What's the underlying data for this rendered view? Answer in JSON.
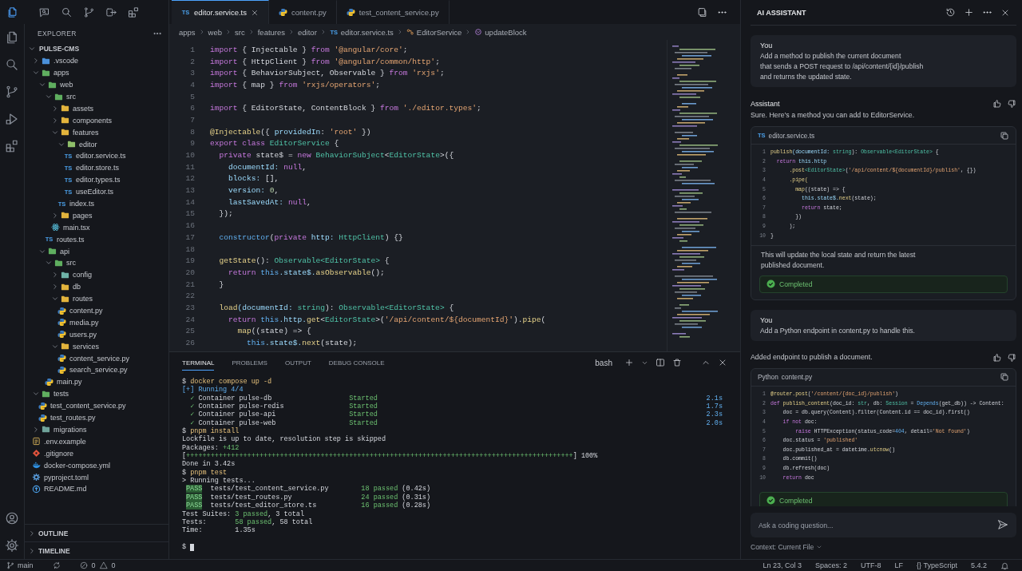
{
  "top_bar": {
    "icons": [
      {
        "kind": "files",
        "selected": true
      },
      {
        "kind": "chat",
        "selected": false
      },
      {
        "kind": "search",
        "selected": false
      },
      {
        "kind": "branch",
        "selected": false
      },
      {
        "kind": "remote",
        "selected": false
      },
      {
        "kind": "ext",
        "selected": false
      }
    ]
  },
  "activity_bar": {
    "items": [
      {
        "kind": "files"
      },
      {
        "kind": "search"
      },
      {
        "kind": "branch"
      },
      {
        "kind": "run"
      },
      {
        "kind": "ext"
      }
    ],
    "bottom": [
      {
        "kind": "account"
      },
      {
        "kind": "gear"
      }
    ]
  },
  "explorer": {
    "title": "EXPLORER",
    "root": {
      "name": "PULSE-CMS",
      "kind": "folder",
      "expanded": true,
      "children": [
        {
          "name": ".vscode",
          "kind": "folder",
          "color": "#4a90d9",
          "expanded": false
        },
        {
          "name": "apps",
          "kind": "folder",
          "color": "#5fae5f",
          "expanded": true,
          "children": [
            {
              "name": "web",
              "kind": "folder",
              "color": "#5fae5f",
              "expanded": true,
              "children": [
                {
                  "name": "src",
                  "kind": "folder",
                  "color": "#5fae5f",
                  "expanded": true,
                  "children": [
                    {
                      "name": "assets",
                      "kind": "folder",
                      "color": "#e2b33c",
                      "expanded": false
                    },
                    {
                      "name": "components",
                      "kind": "folder",
                      "color": "#e2b33c",
                      "expanded": false
                    },
                    {
                      "name": "features",
                      "kind": "folder",
                      "color": "#e2b33c",
                      "expanded": true,
                      "children": [
                        {
                          "name": "editor",
                          "kind": "folder",
                          "color": "#8fbf6a",
                          "expanded": true,
                          "children": [
                            {
                              "name": "editor.service.ts",
                              "kind": "ts",
                              "badge": "TS"
                            },
                            {
                              "name": "editor.store.ts",
                              "kind": "ts",
                              "badge": "TS"
                            },
                            {
                              "name": "editor.types.ts",
                              "kind": "ts",
                              "badge": "TS"
                            },
                            {
                              "name": "useEditor.ts",
                              "kind": "ts",
                              "badge": "TS"
                            }
                          ]
                        },
                        {
                          "name": "index.ts",
                          "kind": "ts",
                          "badge": "TS"
                        }
                      ]
                    },
                    {
                      "name": "pages",
                      "kind": "folder",
                      "color": "#e2b33c",
                      "expanded": false
                    },
                    {
                      "name": "main.tsx",
                      "kind": "react"
                    }
                  ]
                },
                {
                  "name": "routes.ts",
                  "kind": "ts",
                  "badge": "TS"
                }
              ]
            },
            {
              "name": "api",
              "kind": "folder",
              "color": "#5fae5f",
              "expanded": true,
              "children": [
                {
                  "name": "src",
                  "kind": "folder",
                  "color": "#5fae5f",
                  "expanded": true,
                  "children": [
                    {
                      "name": "config",
                      "kind": "folder",
                      "color": "#6fb3a8",
                      "expanded": false
                    },
                    {
                      "name": "db",
                      "kind": "folder",
                      "color": "#e2b33c",
                      "expanded": false
                    },
                    {
                      "name": "routes",
                      "kind": "folder",
                      "color": "#e2b33c",
                      "expanded": true,
                      "children": [
                        {
                          "name": "content.py",
                          "kind": "py"
                        },
                        {
                          "name": "media.py",
                          "kind": "py"
                        },
                        {
                          "name": "users.py",
                          "kind": "py"
                        }
                      ]
                    },
                    {
                      "name": "services",
                      "kind": "folder",
                      "color": "#e2b33c",
                      "expanded": true,
                      "children": [
                        {
                          "name": "content_service.py",
                          "kind": "py"
                        },
                        {
                          "name": "search_service.py",
                          "kind": "py"
                        }
                      ]
                    }
                  ]
                },
                {
                  "name": "main.py",
                  "kind": "py"
                }
              ]
            }
          ]
        },
        {
          "name": "tests",
          "kind": "folder",
          "color": "#5fae5f",
          "expanded": true,
          "children": [
            {
              "name": "test_content_service.py",
              "kind": "py"
            },
            {
              "name": "test_routes.py",
              "kind": "py"
            }
          ]
        },
        {
          "name": "migrations",
          "kind": "folder",
          "color": "#6fa39a",
          "expanded": false
        },
        {
          "name": ".env.example",
          "kind": "env"
        },
        {
          "name": ".gitignore",
          "kind": "git"
        },
        {
          "name": "docker-compose.yml",
          "kind": "docker"
        },
        {
          "name": "pyproject.toml",
          "kind": "toml"
        },
        {
          "name": "README.md",
          "kind": "md"
        }
      ]
    },
    "sections": [
      {
        "label": "OUTLINE",
        "expanded": false
      },
      {
        "label": "TIMELINE",
        "expanded": false
      }
    ]
  },
  "editor": {
    "tabs": [
      {
        "label": "editor.service.ts",
        "kind": "ts",
        "badge": "TS",
        "selected": true
      },
      {
        "label": "content.py",
        "kind": "py",
        "selected": false
      },
      {
        "label": "test_content_service.py",
        "kind": "py",
        "selected": false
      }
    ],
    "breadcrumb": [
      {
        "label": "apps",
        "kind": "folder"
      },
      {
        "label": "web",
        "kind": "folder"
      },
      {
        "label": "src",
        "kind": "folder"
      },
      {
        "label": "features",
        "kind": "folder"
      },
      {
        "label": "editor",
        "kind": "folder"
      },
      {
        "label": "editor.service.ts",
        "kind": "ts",
        "badge": "TS"
      },
      {
        "label": "EditorService",
        "kind": "class"
      },
      {
        "label": "updateBlock",
        "kind": "method"
      }
    ],
    "lines": [
      {
        "n": "1",
        "tokens": [
          {
            "text": "import ",
            "kind": "kw"
          },
          {
            "text": "{ Injectable } ",
            "kind": "p"
          },
          {
            "text": "from ",
            "kind": "kw"
          },
          {
            "text": "'@angular/core'",
            "kind": "str"
          },
          {
            "text": ";",
            "kind": "p"
          }
        ]
      },
      {
        "n": "2",
        "tokens": [
          {
            "text": "import ",
            "kind": "kw"
          },
          {
            "text": "{ HttpClient } ",
            "kind": "p"
          },
          {
            "text": "from ",
            "kind": "kw"
          },
          {
            "text": "'@angular/common/http'",
            "kind": "str"
          },
          {
            "text": ";",
            "kind": "p"
          }
        ]
      },
      {
        "n": "3",
        "tokens": [
          {
            "text": "import ",
            "kind": "kw"
          },
          {
            "text": "{ BehaviorSubject, Observable } ",
            "kind": "p"
          },
          {
            "text": "from ",
            "kind": "kw"
          },
          {
            "text": "'rxjs'",
            "kind": "str"
          },
          {
            "text": ";",
            "kind": "p"
          }
        ]
      },
      {
        "n": "4",
        "tokens": [
          {
            "text": "import ",
            "kind": "kw"
          },
          {
            "text": "{ map } ",
            "kind": "p"
          },
          {
            "text": "from ",
            "kind": "kw"
          },
          {
            "text": "'rxjs/operators'",
            "kind": "str"
          },
          {
            "text": ";",
            "kind": "p"
          }
        ]
      },
      {
        "n": "5"
      },
      {
        "n": "6",
        "tokens": [
          {
            "text": "import ",
            "kind": "kw"
          },
          {
            "text": "{ EditorState, ContentBlock } ",
            "kind": "p"
          },
          {
            "text": "from ",
            "kind": "kw"
          },
          {
            "text": "'./editor.types'",
            "kind": "str"
          },
          {
            "text": ";",
            "kind": "p"
          }
        ]
      },
      {
        "n": "7"
      },
      {
        "n": "8",
        "tokens": [
          {
            "text": "@Injectable",
            "kind": "fn"
          },
          {
            "text": "({ ",
            "kind": "p"
          },
          {
            "text": "providedIn",
            "kind": "var"
          },
          {
            "text": ": ",
            "kind": "p"
          },
          {
            "text": "'root'",
            "kind": "str"
          },
          {
            "text": " })",
            "kind": "p"
          }
        ]
      },
      {
        "n": "9",
        "tokens": [
          {
            "text": "export class ",
            "kind": "kw"
          },
          {
            "text": "EditorService",
            "kind": "type"
          },
          {
            "text": " {",
            "kind": "p"
          }
        ]
      },
      {
        "n": "10",
        "tokens": [
          {
            "text": "  private",
            "kind": "kw"
          },
          {
            "text": " state$ = ",
            "kind": "p"
          },
          {
            "text": "new ",
            "kind": "kw"
          },
          {
            "text": "BehaviorSubject",
            "kind": "type"
          },
          {
            "text": "<",
            "kind": "p"
          },
          {
            "text": "EditorState",
            "kind": "type"
          },
          {
            "text": ">({",
            "kind": "p"
          }
        ]
      },
      {
        "n": "11",
        "tokens": [
          {
            "text": "    documentId: ",
            "kind": "var"
          },
          {
            "text": "null",
            "kind": "kw"
          },
          {
            "text": ",",
            "kind": "p"
          }
        ]
      },
      {
        "n": "12",
        "tokens": [
          {
            "text": "    blocks: ",
            "kind": "var"
          },
          {
            "text": "[],",
            "kind": "p"
          }
        ]
      },
      {
        "n": "13",
        "tokens": [
          {
            "text": "    version: ",
            "kind": "var"
          },
          {
            "text": "0",
            "kind": "num"
          },
          {
            "text": ",",
            "kind": "p"
          }
        ]
      },
      {
        "n": "14",
        "tokens": [
          {
            "text": "    lastSavedAt: ",
            "kind": "var"
          },
          {
            "text": "null",
            "kind": "kw"
          },
          {
            "text": ",",
            "kind": "p"
          }
        ]
      },
      {
        "n": "15",
        "tokens": [
          {
            "text": "  });",
            "kind": "p"
          }
        ]
      },
      {
        "n": "16"
      },
      {
        "n": "17",
        "tokens": [
          {
            "text": "  constructor",
            "kind": "this"
          },
          {
            "text": "(",
            "kind": "p"
          },
          {
            "text": "private",
            "kind": "kw"
          },
          {
            "text": " http: ",
            "kind": "var"
          },
          {
            "text": "HttpClient",
            "kind": "type"
          },
          {
            "text": ") {}",
            "kind": "p"
          }
        ]
      },
      {
        "n": "18"
      },
      {
        "n": "19",
        "tokens": [
          {
            "text": "  getState",
            "kind": "fn"
          },
          {
            "text": "(): ",
            "kind": "p"
          },
          {
            "text": "Observable<EditorState>",
            "kind": "type"
          },
          {
            "text": " {",
            "kind": "p"
          }
        ]
      },
      {
        "n": "20",
        "tokens": [
          {
            "text": "    return ",
            "kind": "kw"
          },
          {
            "text": "this",
            "kind": "this"
          },
          {
            "text": ".state$.",
            "kind": "var"
          },
          {
            "text": "asObservable",
            "kind": "fn"
          },
          {
            "text": "();",
            "kind": "p"
          }
        ]
      },
      {
        "n": "21",
        "tokens": [
          {
            "text": "  }",
            "kind": "p"
          }
        ]
      },
      {
        "n": "22"
      },
      {
        "n": "23",
        "tokens": [
          {
            "text": "  load",
            "kind": "fn"
          },
          {
            "text": "(documentId: ",
            "kind": "var"
          },
          {
            "text": "string",
            "kind": "type"
          },
          {
            "text": "): ",
            "kind": "p"
          },
          {
            "text": "Observable<EditorState>",
            "kind": "type"
          },
          {
            "text": " {",
            "kind": "p"
          }
        ]
      },
      {
        "n": "24",
        "tokens": [
          {
            "text": "    return ",
            "kind": "kw"
          },
          {
            "text": "this",
            "kind": "this"
          },
          {
            "text": ".http.",
            "kind": "var"
          },
          {
            "text": "get",
            "kind": "fn"
          },
          {
            "text": "<",
            "kind": "p"
          },
          {
            "text": "EditorState",
            "kind": "type"
          },
          {
            "text": ">(",
            "kind": "p"
          },
          {
            "text": "'/api/content/${documentId}'",
            "kind": "str"
          },
          {
            "text": ").",
            "kind": "p"
          },
          {
            "text": "pipe",
            "kind": "fn"
          },
          {
            "text": "(",
            "kind": "p"
          }
        ]
      },
      {
        "n": "25",
        "tokens": [
          {
            "text": "      map",
            "kind": "fn"
          },
          {
            "text": "((state) => {",
            "kind": "p"
          }
        ]
      },
      {
        "n": "26",
        "tokens": [
          {
            "text": "        this",
            "kind": "this"
          },
          {
            "text": ".state$.",
            "kind": "var"
          },
          {
            "text": "next",
            "kind": "fn"
          },
          {
            "text": "(state);",
            "kind": "p"
          }
        ]
      }
    ]
  },
  "panel": {
    "tabs": [
      {
        "label": "TERMINAL",
        "selected": true
      },
      {
        "label": "PROBLEMS",
        "selected": false
      },
      {
        "label": "OUTPUT",
        "selected": false
      },
      {
        "label": "DEBUG CONSOLE",
        "selected": false
      }
    ],
    "shell": "bash",
    "lines": [
      {
        "kind": "line",
        "segs": [
          {
            "text": "$ ",
            "kind": "p"
          },
          {
            "text": "docker compose up -d",
            "kind": "cmd"
          }
        ]
      },
      {
        "kind": "line",
        "segs": [
          {
            "text": "[+] Running 4/4",
            "kind": "blue"
          }
        ]
      },
      {
        "kind": "line",
        "segs": [
          {
            "text": "  ✓",
            "kind": "green"
          },
          {
            "text": " Container pulse-db                   ",
            "kind": "p"
          },
          {
            "text": "Started",
            "kind": "green"
          }
        ],
        "right": "2.1s"
      },
      {
        "kind": "line",
        "segs": [
          {
            "text": "  ✓",
            "kind": "green"
          },
          {
            "text": " Container pulse-redis                ",
            "kind": "p"
          },
          {
            "text": "Started",
            "kind": "green"
          }
        ],
        "right": "1.7s"
      },
      {
        "kind": "line",
        "segs": [
          {
            "text": "  ✓",
            "kind": "green"
          },
          {
            "text": " Container pulse-api                  ",
            "kind": "p"
          },
          {
            "text": "Started",
            "kind": "green"
          }
        ],
        "right": "2.3s"
      },
      {
        "kind": "line",
        "segs": [
          {
            "text": "  ✓",
            "kind": "green"
          },
          {
            "text": " Container pulse-web                  ",
            "kind": "p"
          },
          {
            "text": "Started",
            "kind": "green"
          }
        ],
        "right": "2.0s"
      },
      {
        "kind": "line",
        "segs": [
          {
            "text": "$ ",
            "kind": "p"
          },
          {
            "text": "pnpm install",
            "kind": "cmd"
          }
        ]
      },
      {
        "kind": "line",
        "segs": [
          {
            "text": "Lockfile is up to date, resolution step is skipped",
            "kind": "p"
          }
        ]
      },
      {
        "kind": "line",
        "segs": [
          {
            "text": "Packages: ",
            "kind": "p"
          },
          {
            "text": "+412",
            "kind": "green"
          }
        ]
      },
      {
        "kind": "line",
        "segs": [
          {
            "text": "[",
            "kind": "p"
          },
          {
            "text": "+++++++++++++++++++++++++++++++++++++++++++++++++++++++++++++++++++++++++++++++++++++++++++++++",
            "kind": "green"
          },
          {
            "text": "] 100%",
            "kind": "p"
          }
        ]
      },
      {
        "kind": "line",
        "segs": [
          {
            "text": "Done in 3.42s",
            "kind": "p"
          }
        ]
      },
      {
        "kind": "line",
        "segs": [
          {
            "text": "$ ",
            "kind": "p"
          },
          {
            "text": "pnpm test",
            "kind": "cmd"
          }
        ]
      },
      {
        "kind": "line",
        "segs": [
          {
            "text": "> Running tests...",
            "kind": "p"
          }
        ]
      },
      {
        "kind": "line",
        "segs": [
          {
            "text": "PASS",
            "kind": "pass"
          },
          {
            "text": "  tests/test_content_service.py        ",
            "kind": "p"
          },
          {
            "text": "18 passed",
            "kind": "green"
          },
          {
            "text": " (0.42s)",
            "kind": "p"
          }
        ]
      },
      {
        "kind": "line",
        "segs": [
          {
            "text": "PASS",
            "kind": "pass"
          },
          {
            "text": "  tests/test_routes.py                 ",
            "kind": "p"
          },
          {
            "text": "24 passed",
            "kind": "green"
          },
          {
            "text": " (0.31s)",
            "kind": "p"
          }
        ]
      },
      {
        "kind": "line",
        "segs": [
          {
            "text": "PASS",
            "kind": "pass"
          },
          {
            "text": "  tests/test_editor_store.ts           ",
            "kind": "p"
          },
          {
            "text": "16 passed",
            "kind": "green"
          },
          {
            "text": " (0.28s)",
            "kind": "p"
          }
        ]
      },
      {
        "kind": "line",
        "segs": [
          {
            "text": "Test Suites: ",
            "kind": "p"
          },
          {
            "text": "3 passed",
            "kind": "green"
          },
          {
            "text": ", 3 total",
            "kind": "p"
          }
        ]
      },
      {
        "kind": "line",
        "segs": [
          {
            "text": "Tests:       ",
            "kind": "p"
          },
          {
            "text": "58 passed",
            "kind": "green"
          },
          {
            "text": ", 58 total",
            "kind": "p"
          }
        ]
      },
      {
        "kind": "line",
        "segs": [
          {
            "text": "Time:        1.35s",
            "kind": "p"
          }
        ]
      },
      {
        "kind": "prompt",
        "segs": [
          {
            "text": "$",
            "kind": "p"
          }
        ]
      }
    ]
  },
  "assistant": {
    "title": "AI ASSISTANT",
    "messages": [
      {
        "kind": "user",
        "author": "You",
        "text": "Add a method to publish the current document\nthat sends a POST request to /api/content/{id}/publish\nand returns the updated state."
      },
      {
        "kind": "assistant",
        "author": "Assistant",
        "text": "Sure. Here’s a method you can add to EditorService.",
        "code": {
          "kind": "ts",
          "badge": "TS",
          "file": "editor.service.ts",
          "lines": [
            {
              "n": "1",
              "tokens": [
                {
                  "text": "publish",
                  "kind": "fn"
                },
                {
                  "text": "(documentId: ",
                  "kind": "var"
                },
                {
                  "text": "string",
                  "kind": "type"
                },
                {
                  "text": "): ",
                  "kind": "p"
                },
                {
                  "text": "Observable<EditorState>",
                  "kind": "type"
                },
                {
                  "text": " {",
                  "kind": "p"
                }
              ]
            },
            {
              "n": "2",
              "tokens": [
                {
                  "text": "  return",
                  "kind": "kw"
                },
                {
                  "text": " this.http",
                  "kind": "var"
                }
              ]
            },
            {
              "n": "3",
              "tokens": [
                {
                  "text": "      .post",
                  "kind": "fn"
                },
                {
                  "text": "<EditorState>",
                  "kind": "type"
                },
                {
                  "text": "(",
                  "kind": "p"
                },
                {
                  "text": "'/api/content/${documentId}/publish'",
                  "kind": "str"
                },
                {
                  "text": ", {})",
                  "kind": "p"
                }
              ]
            },
            {
              "n": "4",
              "tokens": [
                {
                  "text": "      .pipe(",
                  "kind": "fn"
                }
              ]
            },
            {
              "n": "5",
              "tokens": [
                {
                  "text": "        map",
                  "kind": "fn"
                },
                {
                  "text": "((state) => {",
                  "kind": "p"
                }
              ]
            },
            {
              "n": "6",
              "tokens": [
                {
                  "text": "          this.state$.",
                  "kind": "var"
                },
                {
                  "text": "next",
                  "kind": "fn"
                },
                {
                  "text": "(state);",
                  "kind": "p"
                }
              ]
            },
            {
              "n": "7",
              "tokens": [
                {
                  "text": "          return",
                  "kind": "kw"
                },
                {
                  "text": " state;",
                  "kind": "p"
                }
              ]
            },
            {
              "n": "8",
              "tokens": [
                {
                  "text": "        })",
                  "kind": "p"
                }
              ]
            },
            {
              "n": "9",
              "tokens": [
                {
                  "text": "      );",
                  "kind": "p"
                }
              ]
            },
            {
              "n": "10",
              "tokens": [
                {
                  "text": "}",
                  "kind": "p"
                }
              ]
            }
          ]
        },
        "after": "This will update the local state and return the latest\npublished document.",
        "status": "Completed"
      },
      {
        "kind": "user",
        "author": "You",
        "text": "Add a Python endpoint in content.py to handle this."
      },
      {
        "kind": "assistant",
        "text": "Added endpoint to publish a document.",
        "code": {
          "kind": "py",
          "badge": "Python",
          "file": "content.py",
          "lines": [
            {
              "n": "1",
              "tokens": [
                {
                  "text": "@router.post",
                  "kind": "fn"
                },
                {
                  "text": "(",
                  "kind": "p"
                },
                {
                  "text": "'/content/{doc_id}/publish'",
                  "kind": "str"
                },
                {
                  "text": ")",
                  "kind": "p"
                }
              ]
            },
            {
              "n": "2",
              "tokens": [
                {
                  "text": "def",
                  "kind": "kw"
                },
                {
                  "text": " publish_content",
                  "kind": "fn"
                },
                {
                  "text": "(doc_id: ",
                  "kind": "p"
                },
                {
                  "text": "str",
                  "kind": "type"
                },
                {
                  "text": ", db: ",
                  "kind": "p"
                },
                {
                  "text": "Session",
                  "kind": "type"
                },
                {
                  "text": " = ",
                  "kind": "p"
                },
                {
                  "text": "Depends",
                  "kind": "this"
                },
                {
                  "text": "(get_db)) -> Content:",
                  "kind": "p"
                }
              ]
            },
            {
              "n": "3",
              "tokens": [
                {
                  "text": "    doc = db.query(Content).filter(Content.id == doc_id).first()",
                  "kind": "p"
                }
              ]
            },
            {
              "n": "4",
              "tokens": [
                {
                  "text": "    if not",
                  "kind": "kw"
                },
                {
                  "text": " doc:",
                  "kind": "p"
                }
              ]
            },
            {
              "n": "5",
              "tokens": [
                {
                  "text": "        raise",
                  "kind": "kw"
                },
                {
                  "text": " HTTPException(status_code=",
                  "kind": "p"
                },
                {
                  "text": "404",
                  "kind": "this"
                },
                {
                  "text": ", detail=",
                  "kind": "p"
                },
                {
                  "text": "'Not found'",
                  "kind": "str"
                },
                {
                  "text": ")",
                  "kind": "p"
                }
              ]
            },
            {
              "n": "6",
              "tokens": [
                {
                  "text": "    doc.status = ",
                  "kind": "p"
                },
                {
                  "text": "'published'",
                  "kind": "str"
                }
              ]
            },
            {
              "n": "7",
              "tokens": [
                {
                  "text": "    doc.published_at = datetime.",
                  "kind": "p"
                },
                {
                  "text": "utcnow",
                  "kind": "fn"
                },
                {
                  "text": "()",
                  "kind": "p"
                }
              ]
            },
            {
              "n": "8",
              "tokens": [
                {
                  "text": "    db.commit()",
                  "kind": "p"
                }
              ]
            },
            {
              "n": "9",
              "tokens": [
                {
                  "text": "    db.refresh(doc)",
                  "kind": "p"
                }
              ]
            },
            {
              "n": "10",
              "tokens": [
                {
                  "text": "    return",
                  "kind": "kw"
                },
                {
                  "text": " doc",
                  "kind": "p"
                }
              ]
            }
          ]
        },
        "status": "Completed"
      }
    ],
    "input": {
      "placeholder": "Ask a coding question..."
    },
    "context": "Context: Current File"
  },
  "status_bar": {
    "branch": "main",
    "errors": "0",
    "warnings": "0",
    "items": [
      "Ln 23, Col 3",
      "Spaces: 2",
      "UTF-8",
      "LF",
      "{} TypeScript",
      "5.4.2"
    ]
  }
}
